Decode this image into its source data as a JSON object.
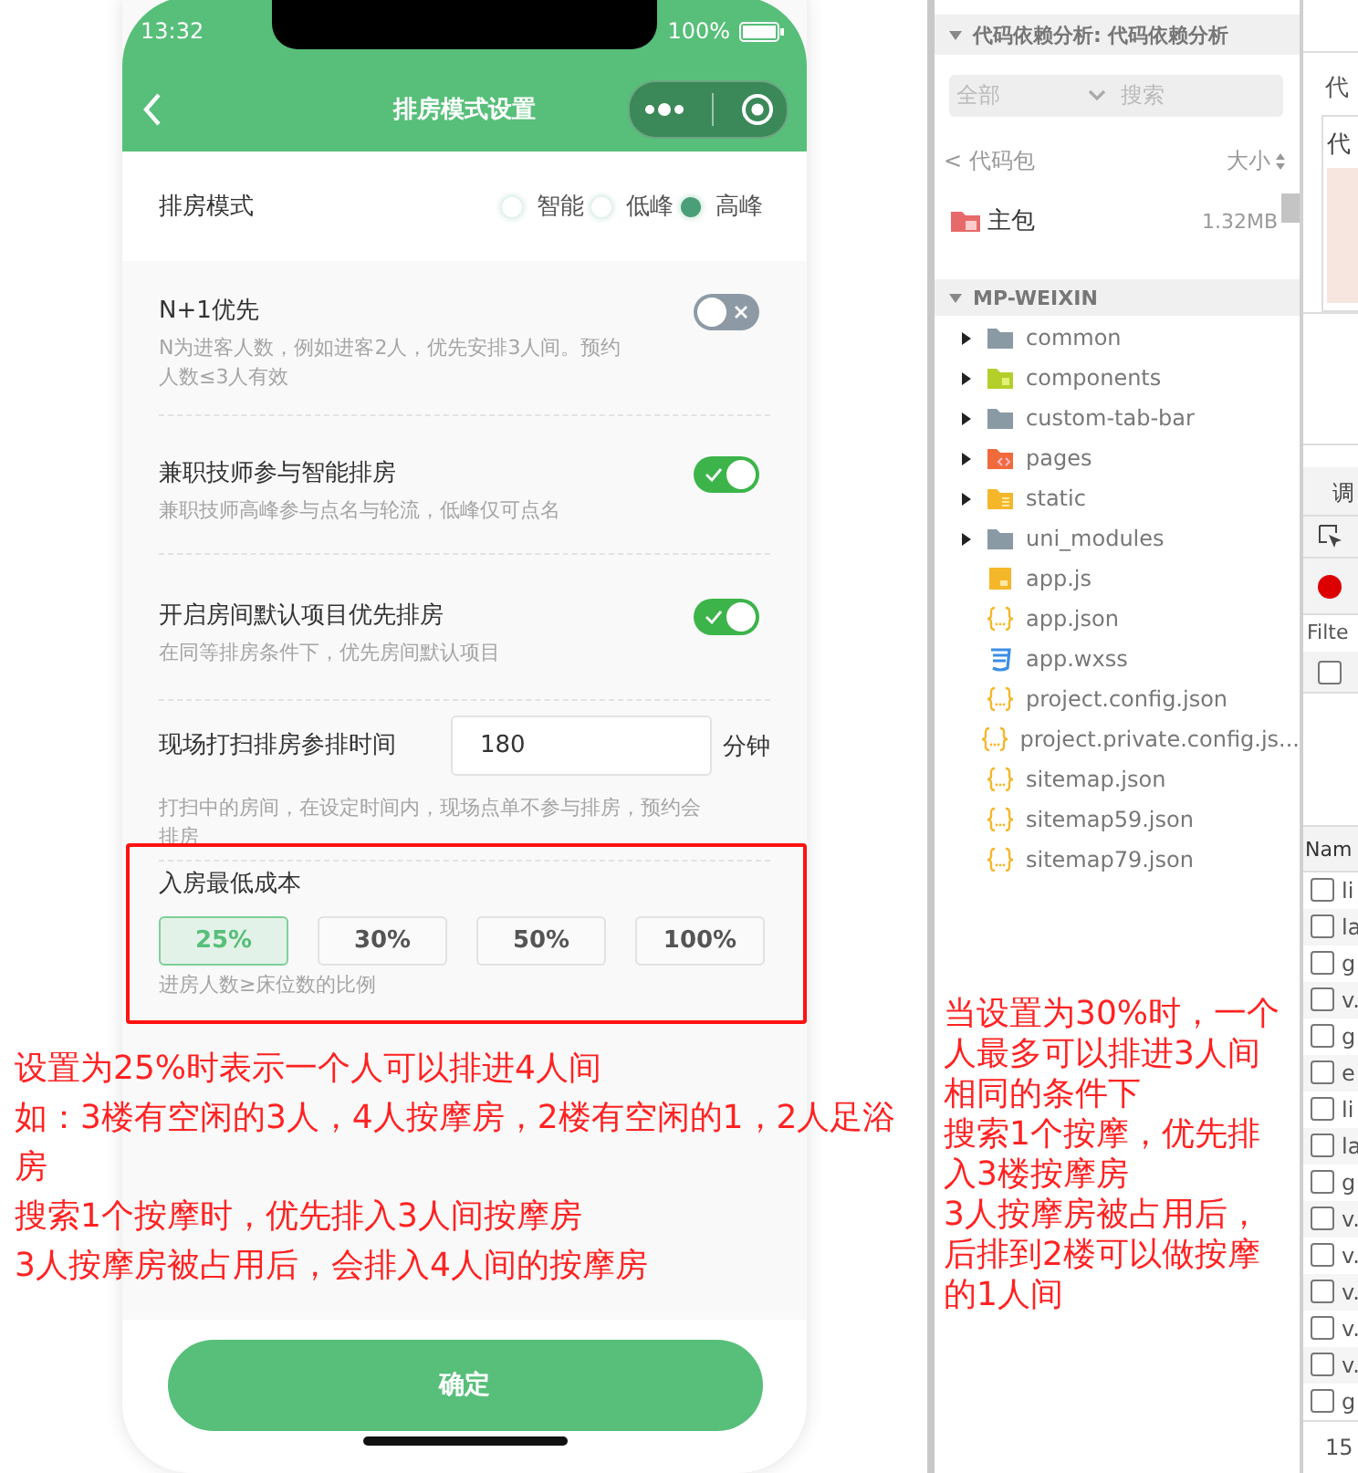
{
  "status_bar": {
    "time": "13:32",
    "battery": "100%"
  },
  "nav": {
    "title": "排房模式设置"
  },
  "mode": {
    "label": "排房模式",
    "options": [
      {
        "label": "智能",
        "selected": false
      },
      {
        "label": "低峰",
        "selected": false
      },
      {
        "label": "高峰",
        "selected": true
      }
    ]
  },
  "settings": [
    {
      "kind": "toggle",
      "title": "N+1优先",
      "description": "N为进客人数，例如进客2人，优先安排3人间。预约人数≤3人有效",
      "on": false
    },
    {
      "kind": "toggle",
      "title": "兼职技师参与智能排房",
      "description": "兼职技师高峰参与点名与轮流，低峰仅可点名",
      "on": true
    },
    {
      "kind": "toggle",
      "title": "开启房间默认项目优先排房",
      "description": "在同等排房条件下，优先房间默认项目",
      "on": true
    },
    {
      "kind": "input",
      "title": "现场打扫排房参排时间",
      "value": "180",
      "unit": "分钟",
      "description": "打扫中的房间，在设定时间内，现场点单不参与排房，预约会排房"
    },
    {
      "kind": "choice",
      "title": "入房最低成本",
      "options": [
        {
          "label": "25%",
          "selected": true
        },
        {
          "label": "30%",
          "selected": false
        },
        {
          "label": "50%",
          "selected": false
        },
        {
          "label": "100%",
          "selected": false
        }
      ],
      "description": "进房人数≥床位数的比例"
    }
  ],
  "confirm_button": "确定",
  "note_left": [
    "设置为25%时表示一个人可以排进4人间",
    "如：3楼有空闲的3人，4人按摩房，2楼有空闲的1，2人足浴房",
    "搜索1个按摩时，优先排入3人间按摩房",
    "3人按摩房被占用后，会排入4人间的按摩房"
  ],
  "file_panel": {
    "dependency_header": "代码依赖分析: 代码依赖分析",
    "filter": "全部",
    "search_placeholder": "搜索",
    "back_label": "< 代码包",
    "size_label": "大小",
    "packages": [
      {
        "name": "主包",
        "size": "1.32MB"
      }
    ],
    "project_header": "MP-WEIXIN",
    "tree": [
      {
        "name": "common",
        "kind": "folder",
        "expanded": false
      },
      {
        "name": "components",
        "kind": "components",
        "expanded": false
      },
      {
        "name": "custom-tab-bar",
        "kind": "folder",
        "expanded": false
      },
      {
        "name": "pages",
        "kind": "pages",
        "expanded": false
      },
      {
        "name": "static",
        "kind": "static",
        "expanded": false
      },
      {
        "name": "uni_modules",
        "kind": "folder",
        "expanded": false
      },
      {
        "name": "app.js",
        "kind": "script"
      },
      {
        "name": "app.json",
        "kind": "json"
      },
      {
        "name": "app.wxss",
        "kind": "style"
      },
      {
        "name": "project.config.json",
        "kind": "json"
      },
      {
        "name": "project.private.config.js...",
        "kind": "json"
      },
      {
        "name": "sitemap.json",
        "kind": "json"
      },
      {
        "name": "sitemap59.json",
        "kind": "json"
      },
      {
        "name": "sitemap79.json",
        "kind": "json"
      }
    ]
  },
  "note_right": [
    "当设置为30%时，一个人最多可以排进3人间",
    "相同的条件下",
    "搜索1个按摩，优先排入3楼按摩房",
    "3人按摩房被占用后，后排到2楼可以做按摩的1人间"
  ],
  "devtools": {
    "label": "代",
    "card_title": "代",
    "tab": "调",
    "filter_placeholder": "Filte",
    "filter_checkbox": {
      "checked": false
    },
    "column": "Nam",
    "rows": [
      {
        "text": "li",
        "checked": false
      },
      {
        "text": "la",
        "checked": false
      },
      {
        "text": "g",
        "checked": false
      },
      {
        "text": "v.",
        "checked": false
      },
      {
        "text": "g",
        "checked": false
      },
      {
        "text": "e",
        "checked": false
      },
      {
        "text": "li",
        "checked": false
      },
      {
        "text": "la",
        "checked": false
      },
      {
        "text": "g",
        "checked": false
      },
      {
        "text": "v.",
        "checked": false
      },
      {
        "text": "v.",
        "checked": false
      },
      {
        "text": "v.",
        "checked": false
      },
      {
        "text": "v.",
        "checked": false
      },
      {
        "text": "v.",
        "checked": false
      },
      {
        "text": "g",
        "checked": false
      }
    ],
    "footer": "15"
  }
}
